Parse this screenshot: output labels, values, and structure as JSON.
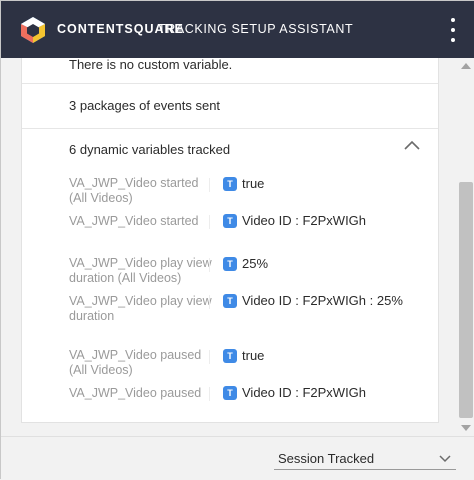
{
  "header": {
    "brand": "CONTENTSQUARE",
    "title": "TRACKING SETUP ASSISTANT",
    "accent_color": "#2d3243"
  },
  "panel": {
    "custom_variables_text": "There is no custom variable.",
    "packages_text": "3 packages of events sent",
    "dynamic_variables_header": "6 dynamic variables tracked",
    "variables": [
      {
        "name_line1": "VA_JWP_Video started",
        "name_line2": "(All Videos)",
        "type": "T",
        "value": "true"
      },
      {
        "name_line1": "VA_JWP_Video started",
        "name_line2": "",
        "type": "T",
        "value": "Video ID : F2PxWIGh"
      },
      {
        "name_line1": "VA_JWP_Video play view",
        "name_line2": "duration (All Videos)",
        "type": "T",
        "value": "25%"
      },
      {
        "name_line1": "VA_JWP_Video play view",
        "name_line2": "duration",
        "type": "T",
        "value": "Video ID : F2PxWIGh : 25%"
      },
      {
        "name_line1": "VA_JWP_Video paused",
        "name_line2": "(All Videos)",
        "type": "T",
        "value": "true"
      },
      {
        "name_line1": "VA_JWP_Video paused",
        "name_line2": "",
        "type": "T",
        "value": "Video ID : F2PxWIGh"
      }
    ]
  },
  "footer": {
    "select_value": "Session Tracked"
  }
}
